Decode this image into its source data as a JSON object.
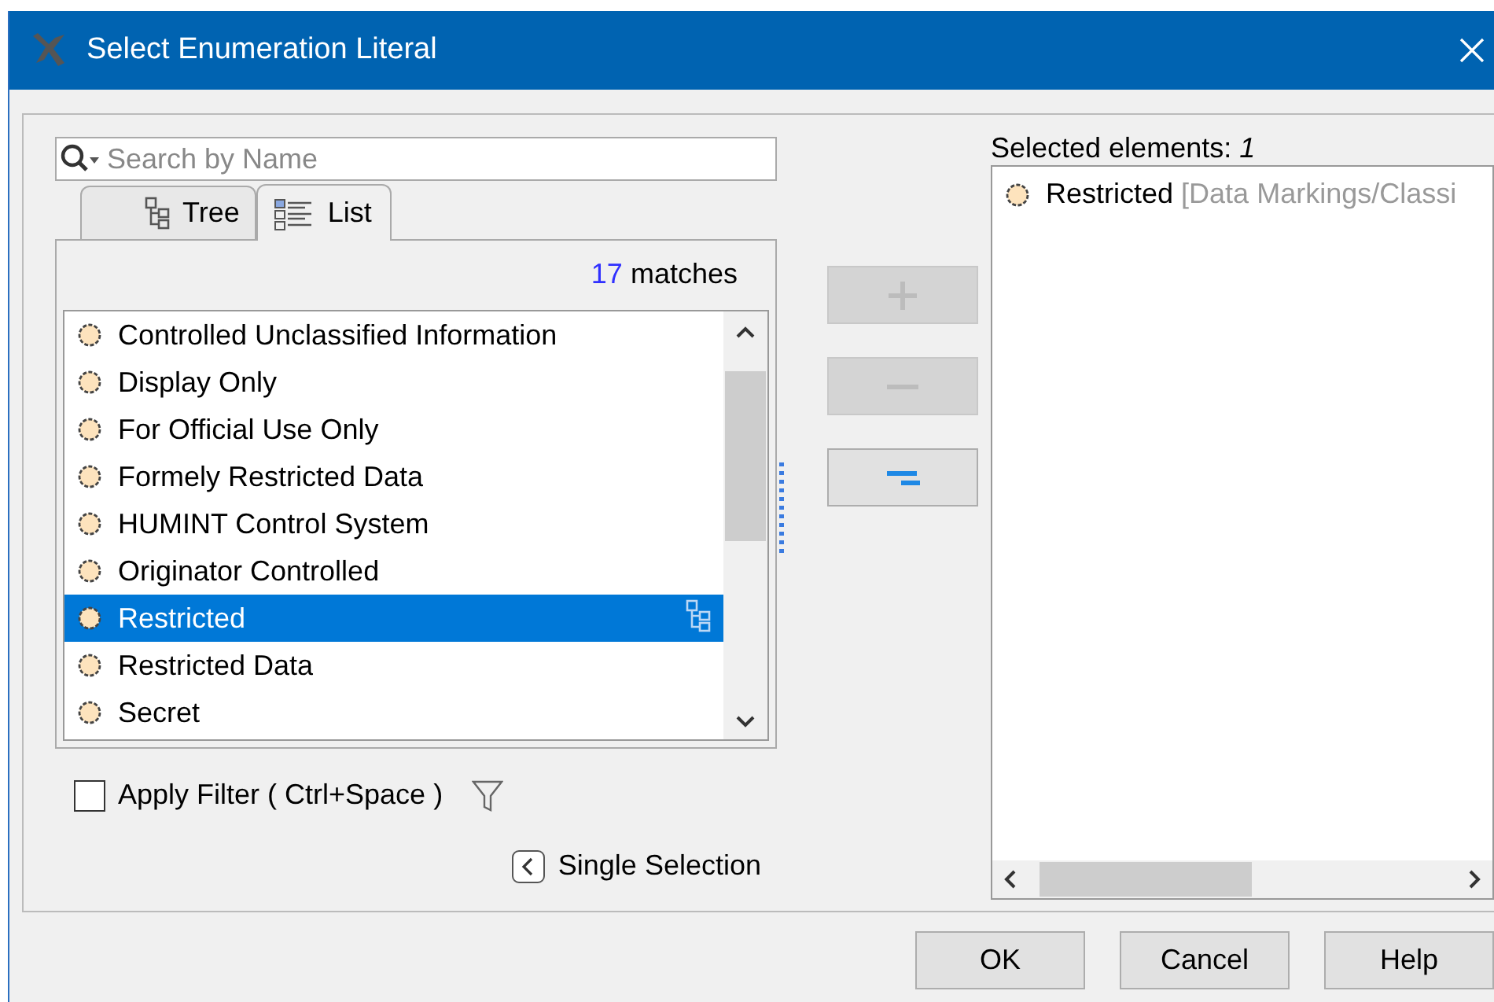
{
  "window": {
    "title": "Select Enumeration Literal"
  },
  "search": {
    "placeholder": "Search by Name"
  },
  "tabs": [
    {
      "label": "Tree",
      "selected": false
    },
    {
      "label": "List",
      "selected": true
    }
  ],
  "matches": {
    "count": "17",
    "label": "matches"
  },
  "items": [
    {
      "label": "Controlled Unclassified Information",
      "selected": false
    },
    {
      "label": "Display Only",
      "selected": false
    },
    {
      "label": "For Official Use Only",
      "selected": false
    },
    {
      "label": "Formely Restricted Data",
      "selected": false
    },
    {
      "label": "HUMINT Control System",
      "selected": false
    },
    {
      "label": "Originator Controlled",
      "selected": false
    },
    {
      "label": "Restricted",
      "selected": true
    },
    {
      "label": "Restricted Data",
      "selected": false
    },
    {
      "label": "Secret",
      "selected": false
    }
  ],
  "transfer_buttons": [
    {
      "kind": "add",
      "disabled": true
    },
    {
      "kind": "remove",
      "disabled": true
    },
    {
      "kind": "remove_all",
      "disabled": false
    }
  ],
  "filter": {
    "label": "Apply Filter ( Ctrl+Space )",
    "checked": false
  },
  "single_selection": {
    "label": "Single Selection"
  },
  "selected_panel": {
    "label": "Selected elements:",
    "count": "1",
    "items": [
      {
        "name": "Restricted",
        "path": "[Data Markings/Classi"
      }
    ]
  },
  "buttons": [
    "OK",
    "Cancel",
    "Help"
  ]
}
